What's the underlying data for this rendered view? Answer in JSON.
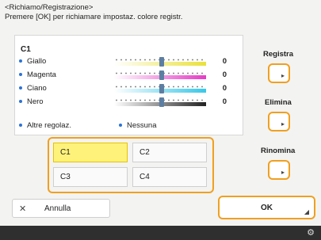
{
  "header": {
    "title": "<Richiamo/Registrazione>",
    "subtitle": "Premere [OK] per richiamare impostaz. colore registr."
  },
  "panel": {
    "title": "C1",
    "rows": [
      {
        "label": "Giallo",
        "value": "0",
        "bar_color": "#e9e13a"
      },
      {
        "label": "Magenta",
        "value": "0",
        "bar_color": "#e53cc6"
      },
      {
        "label": "Ciano",
        "value": "0",
        "bar_color": "#38c8e8"
      },
      {
        "label": "Nero",
        "value": "0",
        "bar_color": "#222222"
      }
    ],
    "other_label": "Altre regolaz.",
    "other_value": "Nessuna"
  },
  "grid": {
    "cells": [
      "C1",
      "C2",
      "C3",
      "C4"
    ],
    "selected": "C1"
  },
  "side": {
    "registra": "Registra",
    "elimina": "Elimina",
    "rinomina": "Rinomina"
  },
  "footer_buttons": {
    "cancel": "Annulla",
    "ok": "OK"
  },
  "colors": {
    "accent": "#f0a020",
    "selected": "#fff27a",
    "bullet": "#2a72d6"
  }
}
